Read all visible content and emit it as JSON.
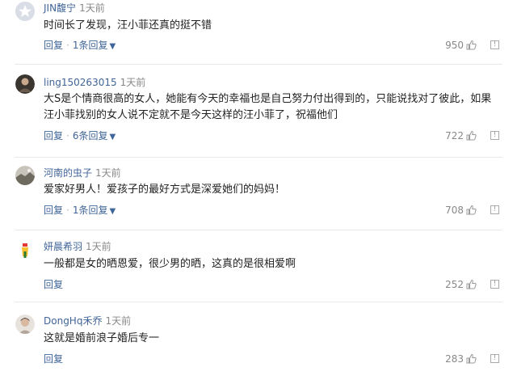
{
  "comments": [
    {
      "username": "JIN馥宁",
      "time": "1天前",
      "text": "时间长了发现，汪小菲还真的挺不错",
      "reply_label": "回复",
      "replies_label": "1条回复",
      "likes": "950",
      "avatar_style": "star"
    },
    {
      "username": "ling150263015",
      "time": "1天前",
      "text": "大S是个情商很高的女人，她能有今天的幸福也是自己努力付出得到的，只能说找对了彼此，如果汪小菲找别的女人说不定就不是今天这样的汪小菲了，祝福他们",
      "reply_label": "回复",
      "replies_label": "6条回复",
      "likes": "722",
      "avatar_style": "photo-dark"
    },
    {
      "username": "河南的虫子",
      "time": "1天前",
      "text": "爱家好男人！爱孩子的最好方式是深爱她们的妈妈！",
      "reply_label": "回复",
      "replies_label": "1条回复",
      "likes": "708",
      "avatar_style": "photo-landscape"
    },
    {
      "username": "妍晨希羽",
      "time": "1天前",
      "text": "一般都是女的晒恩爱，很少男的晒，这真的是很相爱啊",
      "reply_label": "回复",
      "replies_label": "",
      "likes": "252",
      "avatar_style": "cartoon"
    },
    {
      "username": "DongHq禾乔",
      "time": "1天前",
      "text": "这就是婚前浪子婚后专一",
      "reply_label": "回复",
      "replies_label": "",
      "likes": "283",
      "avatar_style": "photo-face"
    }
  ],
  "colors": {
    "link": "#406599",
    "meta": "#888888",
    "text": "#222222"
  }
}
